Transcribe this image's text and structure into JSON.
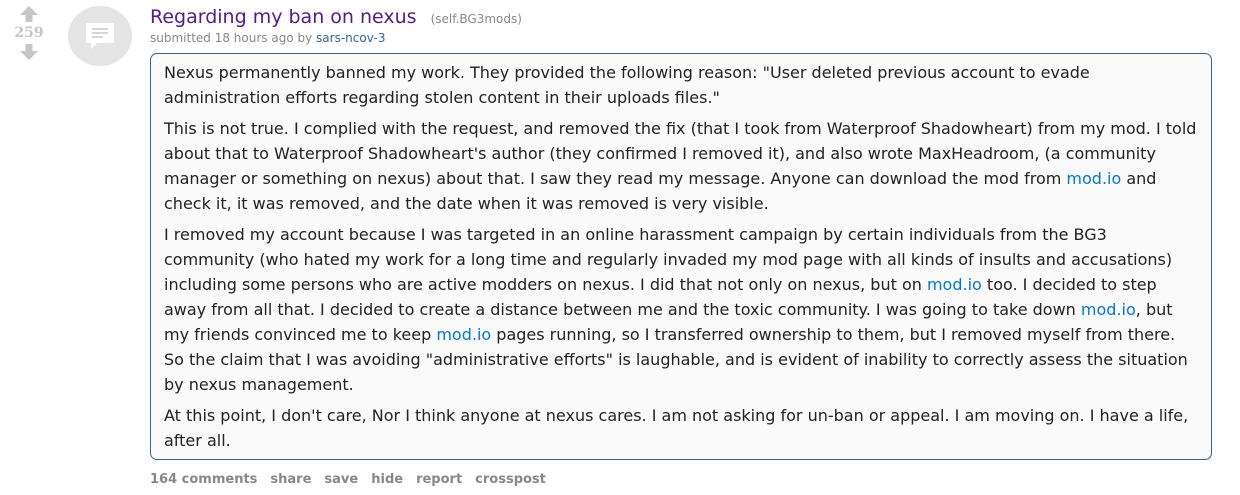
{
  "post": {
    "score": "259",
    "title": "Regarding my ban on nexus",
    "domain": "(self.BG3mods)",
    "tagline": {
      "prefix": "submitted 18 hours ago by",
      "author": "sars-ncov-3"
    },
    "body": {
      "p1": "Nexus permanently banned my work. They provided the following reason: \"User deleted previous account to evade administration efforts regarding stolen content in their uploads files.\"",
      "p2": {
        "t1": "This is not true. I complied with the request, and removed the fix (that I took from Waterproof Shadowheart) from my mod. I told about that to Waterproof Shadowheart's author (they confirmed I removed it), and also wrote MaxHeadroom, (a community manager or something on nexus) about that. I saw they read my message. Anyone can download the mod from",
        "link1": "mod.io",
        "t2": "and check it, it was removed, and the date when it was removed is very visible."
      },
      "p3": {
        "t1": "I removed my account because I was targeted in an online harassment campaign by certain individuals from the BG3 community (who hated my work for a long time and regularly invaded my mod page with all kinds of insults and accusations) including some persons who are active modders on nexus. I did that not only on nexus, but on",
        "link1": "mod.io",
        "t2": "too. I decided to step away from all that. I decided to create a distance between me and the toxic community. I was going to take down",
        "link2": "mod.io",
        "t3": ", but my friends convinced me to keep",
        "link3": "mod.io",
        "t4": "pages running, so I transferred ownership to them, but I removed myself from there. So the claim that I was avoiding \"administrative efforts\" is laughable, and is evident of inability to correctly assess the situation by nexus management."
      },
      "p4": "At this point, I don't care, Nor I think anyone at nexus cares. I am not asking for un-ban or appeal. I am moving on. I have a life, after all."
    },
    "buttons": {
      "comments": "164 comments",
      "share": "share",
      "save": "save",
      "hide": "hide",
      "report": "report",
      "crosspost": "crosspost"
    }
  },
  "icons": {
    "upvote": "upvote-arrow-icon",
    "downvote": "downvote-arrow-icon",
    "thumbnail": "self-post-text-icon"
  },
  "colors": {
    "title": "#551a8b",
    "link": "#0079d3",
    "author": "#336699",
    "muted": "#888888",
    "expando_border": "#336699",
    "expando_bg": "#fafafa",
    "arrow": "#c6c6c6"
  }
}
